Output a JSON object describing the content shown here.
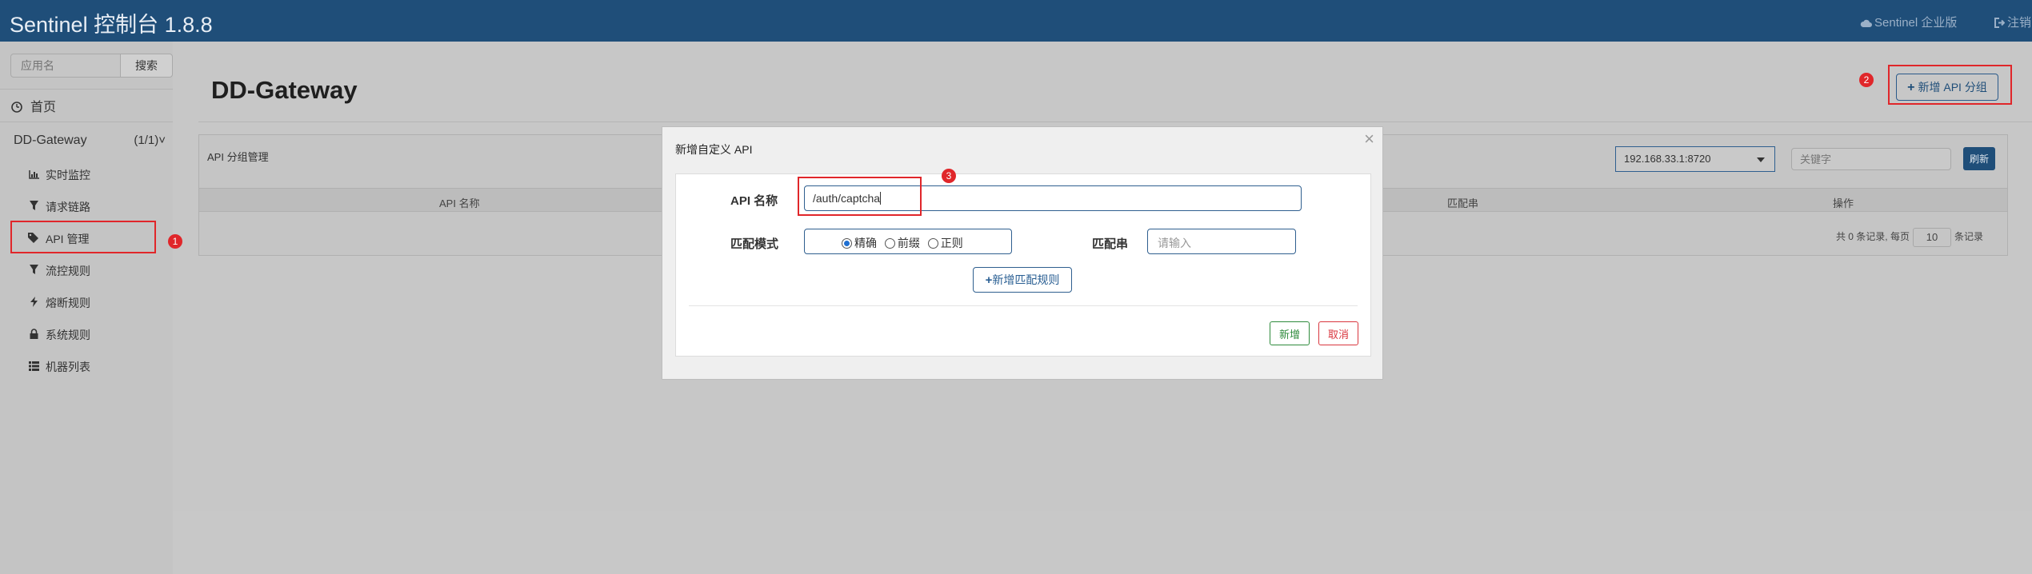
{
  "header": {
    "brand": "Sentinel 控制台 1.8.8",
    "enterprise_link": "Sentinel 企业版",
    "logout_link": "注销"
  },
  "sidebar": {
    "search_placeholder": "应用名",
    "search_button": "搜索",
    "home_label": "首页",
    "app_name": "DD-Gateway",
    "app_count": "(1/1)",
    "items": [
      {
        "icon": "bar-chart-icon",
        "label": "实时监控"
      },
      {
        "icon": "filter-icon",
        "label": "请求链路"
      },
      {
        "icon": "tags-icon",
        "label": "API 管理"
      },
      {
        "icon": "filter-icon",
        "label": "流控规则"
      },
      {
        "icon": "flash-icon",
        "label": "熔断规则"
      },
      {
        "icon": "lock-icon",
        "label": "系统规则"
      },
      {
        "icon": "list-icon",
        "label": "机器列表"
      }
    ]
  },
  "main": {
    "title": "DD-Gateway",
    "add_group_button": "新增 API 分组",
    "panel_title": "API 分组管理",
    "machine_select": "192.168.33.1:8720",
    "keyword_placeholder": "关键字",
    "refresh_button": "刷新",
    "columns": [
      "API 名称",
      "匹配串",
      "操作"
    ],
    "pager": {
      "prefix": "共 0 条记录, 每页",
      "page_size": "10",
      "suffix": "条记录"
    }
  },
  "modal": {
    "title": "新增自定义 API",
    "api_name_label": "API 名称",
    "api_name_value": "/auth/captcha",
    "match_mode_label": "匹配模式",
    "match_modes": [
      "精确",
      "前缀",
      "正则"
    ],
    "selected_mode": "精确",
    "pattern_label": "匹配串",
    "pattern_placeholder": "请输入",
    "add_rule_button": "新增匹配规则",
    "ok_button": "新增",
    "cancel_button": "取消"
  },
  "annotations": {
    "badge_1": "1",
    "badge_2": "2",
    "badge_3": "3",
    "color": "#e0262a"
  },
  "colors": {
    "navbar": "#1f4e79",
    "accent": "#2f5f8f",
    "success": "#2e8b3c",
    "danger": "#d9363e"
  }
}
